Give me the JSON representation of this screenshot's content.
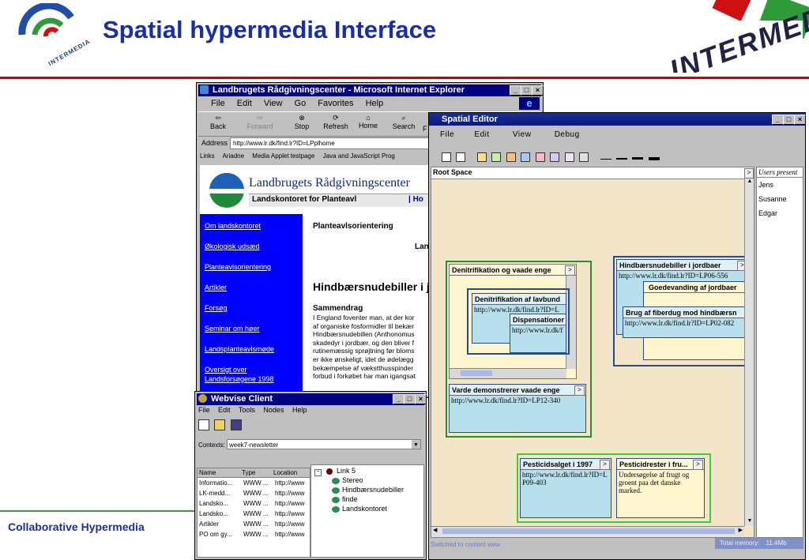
{
  "slide": {
    "title": "Spatial hypermedia Interface",
    "footer": "Collaborative Hypermedia",
    "logo_text": "INTERMEDIA",
    "corner_banner_text": "INTERMEDIA",
    "rule_color": "#cc0000",
    "title_color": "#1a2fa0"
  },
  "ie_window": {
    "title": "Landbrugets Rådgivningscenter - Microsoft Internet Explorer",
    "menu": [
      "File",
      "Edit",
      "View",
      "Go",
      "Favorites",
      "Help"
    ],
    "toolbar": [
      "Back",
      "Forward",
      "Stop",
      "Refresh",
      "Home",
      "Search",
      "F"
    ],
    "address_label": "Address",
    "address_value": "http://www.lr.dk/find.lr?ID=LPplhome",
    "links_label": "Links",
    "links": [
      "Ariadne",
      "Media Applet testpage",
      "Java and JavaScript Prog"
    ],
    "site_name": "Landbrugets Rådgivningscenter",
    "site_sub": "Landskontoret for Planteavl",
    "site_sub_right": "| Ho",
    "nav": [
      "Om landskontoret",
      "Økologisk udsæd",
      "Planteavlsorientering",
      "Artikler",
      "Forsøg",
      "Seminar om høer",
      "Landsplanteavlsmøde",
      "Oversigt over",
      "Landsforsøgene 1998"
    ],
    "section": "Planteavlsorientering",
    "section_right": "Lan",
    "article_title": "Hindbærsnudebiller i jo",
    "summary_label": "Sammendrag",
    "body_lines": [
      "I England foventer man, at der kor",
      "af organiske fosformidler til bekær",
      "Hindbærsnudebillen (Anthonomus",
      "skadedyr i jordbær, og den bliver f",
      "rutinemæssig sprøjtning før bloms",
      "er ikke ønskeligt, idet de ødelægg",
      "bekæmpelse af vækstthusspinder",
      "forbud i forkøbet har man igangsat"
    ]
  },
  "spatial_editor": {
    "title": "Spatial Editor",
    "menu": [
      "File",
      "Edit",
      "View",
      "Debug"
    ],
    "root_label": "Root Space",
    "users_header": "Users present",
    "users": [
      "Jens",
      "Susanne",
      "Edgar"
    ],
    "status_left": "Switched to content view",
    "status_mid": "Total memory:",
    "status_right": "11.4Mb",
    "nodes": {
      "denitrifikation_vaade": "Denitrifikation og vaade enge",
      "denitrifikation_lav": "Denitrifikation af lavbund",
      "denitrifikation_lav_url": "http://www.lr.dk/find.lr?ID=L",
      "dispensationer": "Dispensationer",
      "dispensationer_url": "http://www.lr.dk/f",
      "varde": "Varde demonstrerer vaade enge",
      "varde_url": "http://www.lr.dk/find.lr?ID=LP12-340",
      "hindbaer": "Hindbærsnudebiller i jordbaer",
      "hindbaer_url": "http://www.lr.dk/find.lr?ID=LP06-556",
      "goedevanding": "Goedevanding af jordbaer",
      "fiberdug": "Brug af fiberdug mod hindbærsn",
      "fiberdug_url": "http://www.lr.dk/find.lr?ID=LP02-082",
      "pesticidsalget": "Pesticidsalget i 1997",
      "pesticidsalget_url": "http://www.lr.dk/find.lr?ID=LP09-403",
      "pesticidrester": "Pesticidrester i fru...",
      "pesticidrester_text": "Undersøgelse af frugt og groent paa det danske marked."
    }
  },
  "webvise": {
    "title": "Webvise Client",
    "menu": [
      "File",
      "Edit",
      "Tools",
      "Nodes",
      "Help"
    ],
    "contexts_label": "Contexts:",
    "contexts_value": "week7-newsletter",
    "columns": [
      "Name",
      "Type",
      "Location"
    ],
    "rows": [
      [
        "Informatio...",
        "WWW ...",
        "http://www"
      ],
      [
        "LK-medd...",
        "WWW ...",
        "http://www"
      ],
      [
        "Landsko...",
        "WWW ...",
        "http://www"
      ],
      [
        "Landsko...",
        "WWW ...",
        "http://www"
      ],
      [
        "Artikler",
        "WWW ...",
        "http://www"
      ],
      [
        "PO om gy...",
        "WWW ...",
        "http://www"
      ]
    ],
    "tree_root": "Link 5",
    "tree_items": [
      "Stereo",
      "Hindbærsnudebiller",
      "finde",
      "Landskontoret"
    ]
  }
}
